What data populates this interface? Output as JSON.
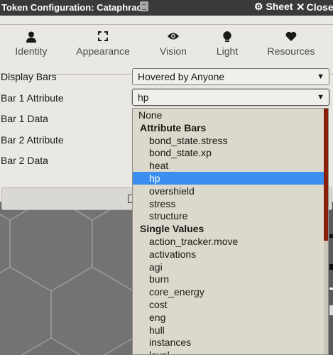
{
  "window": {
    "title": "Token Configuration: Cataphract",
    "sheet_label": "Sheet",
    "close_label": "Close"
  },
  "tabs": [
    {
      "label": "Identity",
      "icon": "user-icon"
    },
    {
      "label": "Appearance",
      "icon": "expand-icon"
    },
    {
      "label": "Vision",
      "icon": "eye-icon"
    },
    {
      "label": "Light",
      "icon": "lightbulb-icon"
    },
    {
      "label": "Resources",
      "icon": "heart-icon",
      "active": true
    }
  ],
  "fields": {
    "display_bars": {
      "label": "Display Bars",
      "value": "Hovered by Anyone"
    },
    "bar1_attribute": {
      "label": "Bar 1 Attribute",
      "value": "hp"
    },
    "bar1_data": {
      "label": "Bar 1 Data"
    },
    "bar2_attribute": {
      "label": "Bar 2 Attribute"
    },
    "bar2_data": {
      "label": "Bar 2 Data"
    }
  },
  "dropdown": {
    "none_label": "None",
    "groups": [
      {
        "label": "Attribute Bars",
        "items": [
          "bond_state.stress",
          "bond_state.xp",
          "heat",
          "hp",
          "overshield",
          "stress",
          "structure"
        ]
      },
      {
        "label": "Single Values",
        "items": [
          "action_tracker.move",
          "activations",
          "agi",
          "burn",
          "core_energy",
          "cost",
          "eng",
          "hull",
          "instances",
          "level"
        ]
      }
    ],
    "selected": "hp"
  },
  "colors": {
    "selection": "#3b8ff0",
    "scroll_thumb": "#8a1e08",
    "panel": "#e9e8e4",
    "list_bg": "#dcd8cc"
  }
}
